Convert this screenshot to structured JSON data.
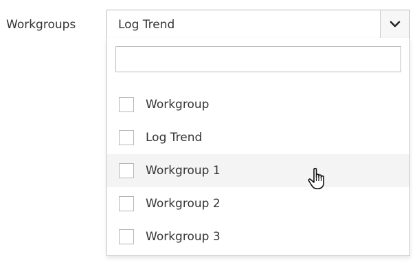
{
  "form": {
    "label": "Workgroups",
    "selected_value": "Log Trend"
  },
  "dropdown": {
    "search_value": "",
    "options": [
      {
        "label": "Workgroup",
        "checked": false
      },
      {
        "label": "Log Trend",
        "checked": false
      },
      {
        "label": "Workgroup 1",
        "checked": false,
        "hovered": true
      },
      {
        "label": "Workgroup 2",
        "checked": false
      },
      {
        "label": "Workgroup 3",
        "checked": false
      }
    ]
  },
  "icons": {
    "toggle": "chevron-down-icon",
    "cursor": "hand-pointer-icon"
  },
  "colors": {
    "border": "#b9b9b9",
    "hover_bg": "#f4f4f4",
    "text": "#333333"
  }
}
